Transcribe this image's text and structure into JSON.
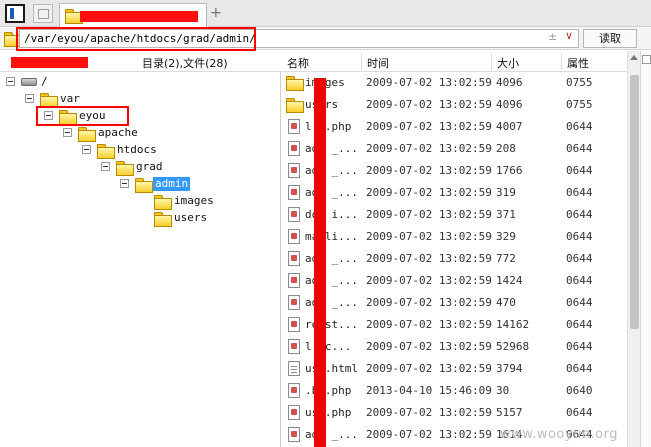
{
  "tabs": {
    "new_tab_symbol": "+"
  },
  "address": {
    "path": "/var/eyou/apache/htdocs/grad/admin/",
    "plusminus": "±",
    "dropdown": "∨",
    "read_button": "读取"
  },
  "tree_header": {
    "summary": "目录(2),文件(28)"
  },
  "tree": [
    {
      "label": "/",
      "level": 0
    },
    {
      "label": "var",
      "level": 1
    },
    {
      "label": "eyou",
      "level": 2
    },
    {
      "label": "apache",
      "level": 3
    },
    {
      "label": "htdocs",
      "level": 4
    },
    {
      "label": "grad",
      "level": 5
    },
    {
      "label": "admin",
      "level": 6,
      "selected": true
    },
    {
      "label": "images",
      "level": 7
    },
    {
      "label": "users",
      "level": 7
    }
  ],
  "columns": {
    "name": "名称",
    "time": "时间",
    "size": "大小",
    "attr": "属性"
  },
  "files": [
    {
      "name": "images",
      "type": "folder",
      "time": "2009-07-02 13:02:59",
      "size": "4096",
      "attr": "0755"
    },
    {
      "name": "users",
      "type": "folder",
      "time": "2009-07-02 13:02:59",
      "size": "4096",
      "attr": "0755"
    },
    {
      "name": "l  g.php",
      "type": "php",
      "time": "2009-07-02 13:02:59",
      "size": "4007",
      "attr": "0644"
    },
    {
      "name": "adm  _...",
      "type": "php",
      "time": "2009-07-02 13:02:59",
      "size": "208",
      "attr": "0644"
    },
    {
      "name": "adm  _...",
      "type": "php",
      "time": "2009-07-02 13:02:59",
      "size": "1766",
      "attr": "0644"
    },
    {
      "name": "adm  _...",
      "type": "php",
      "time": "2009-07-02 13:02:59",
      "size": "319",
      "attr": "0644"
    },
    {
      "name": "dom  i...",
      "type": "php",
      "time": "2009-07-02 13:02:59",
      "size": "371",
      "attr": "0644"
    },
    {
      "name": "ma  li...",
      "type": "php",
      "time": "2009-07-02 13:02:59",
      "size": "329",
      "attr": "0644"
    },
    {
      "name": "adm  _...",
      "type": "php",
      "time": "2009-07-02 13:02:59",
      "size": "772",
      "attr": "0644"
    },
    {
      "name": "adm  _...",
      "type": "php",
      "time": "2009-07-02 13:02:59",
      "size": "1424",
      "attr": "0644"
    },
    {
      "name": "adm  _...",
      "type": "php",
      "time": "2009-07-02 13:02:59",
      "size": "470",
      "attr": "0644"
    },
    {
      "name": "re  st...",
      "type": "php",
      "time": "2009-07-02 13:02:59",
      "size": "14162",
      "attr": "0644"
    },
    {
      "name": "l  _c...",
      "type": "php",
      "time": "2009-07-02 13:02:59",
      "size": "52968",
      "attr": "0644"
    },
    {
      "name": "us  .html",
      "type": "html",
      "time": "2009-07-02 13:02:59",
      "size": "3794",
      "attr": "0644"
    },
    {
      "name": ".b  .php",
      "type": "php",
      "time": "2013-04-10 15:46:09",
      "size": "30",
      "attr": "0640"
    },
    {
      "name": "us  .php",
      "type": "php",
      "time": "2009-07-02 13:02:59",
      "size": "5157",
      "attr": "0644"
    },
    {
      "name": "adm  _...",
      "type": "php",
      "time": "2009-07-02 13:02:59",
      "size": "1614",
      "attr": "0644"
    }
  ],
  "watermark": "www.wooyun.org"
}
